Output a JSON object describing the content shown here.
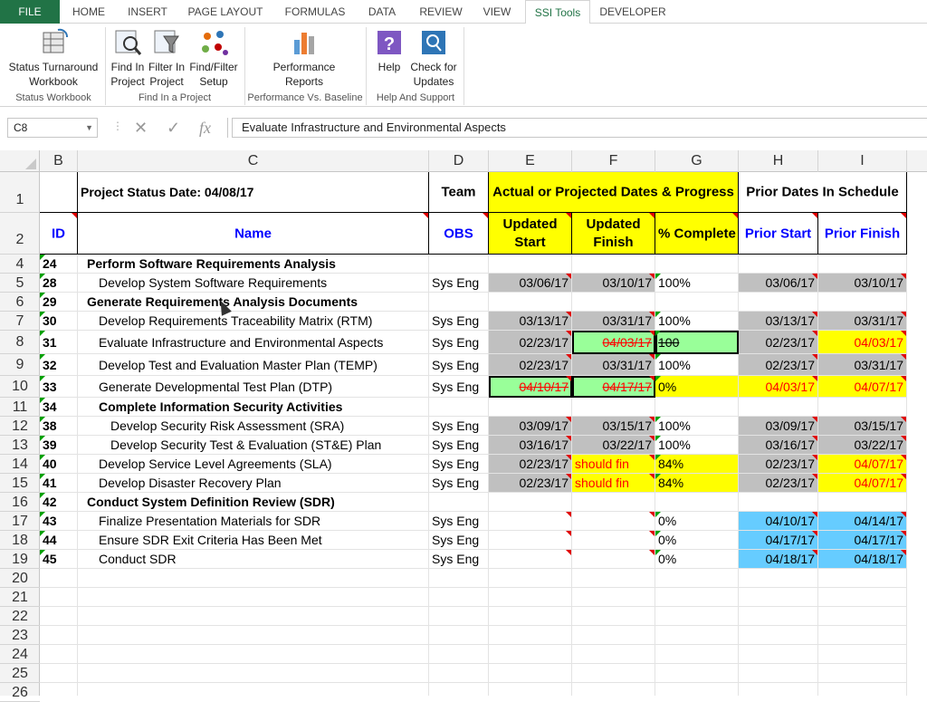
{
  "tabs": [
    "FILE",
    "HOME",
    "INSERT",
    "PAGE LAYOUT",
    "FORMULAS",
    "DATA",
    "REVIEW",
    "VIEW",
    "SSI Tools",
    "DEVELOPER"
  ],
  "ribbon": {
    "status_turnaround": [
      "Status Turnaround",
      "Workbook"
    ],
    "find_in_project": [
      "Find In",
      "Project"
    ],
    "filter_in_project": [
      "Filter In",
      "Project"
    ],
    "find_filter_setup": [
      "Find/Filter",
      "Setup"
    ],
    "performance_reports": [
      "Performance",
      "Reports"
    ],
    "help": "Help",
    "check_updates": [
      "Check for",
      "Updates"
    ],
    "groups": [
      "Status Workbook",
      "Find In a Project",
      "Performance Vs. Baseline",
      "Help And Support"
    ]
  },
  "formula_bar": {
    "name_box": "C8",
    "fx": "fx",
    "value": "Evaluate Infrastructure and Environmental Aspects"
  },
  "columns": [
    "B",
    "C",
    "D",
    "E",
    "F",
    "G",
    "H",
    "I"
  ],
  "rows": [
    "1",
    "2",
    "4",
    "5",
    "6",
    "7",
    "8",
    "9",
    "10",
    "11",
    "12",
    "13",
    "14",
    "15",
    "16",
    "17",
    "18",
    "19",
    "20",
    "21",
    "22",
    "23",
    "24",
    "25",
    "26"
  ],
  "header": {
    "status_date": "Project Status Date: 04/08/17",
    "team": "Team",
    "actual": "Actual or Projected Dates & Progress",
    "prior": "Prior Dates In Schedule",
    "id": "ID",
    "name": "Name",
    "obs": "OBS",
    "upd_start": [
      "Updated",
      "Start"
    ],
    "upd_finish": [
      "Updated",
      "Finish"
    ],
    "pct": "% Complete",
    "prior_start": "Prior Start",
    "prior_finish": "Prior Finish"
  },
  "data_rows": [
    {
      "id": "24",
      "name": "Perform Software Requirements Analysis",
      "summary": true,
      "indent": 1
    },
    {
      "id": "28",
      "name": "Develop System Software Requirements",
      "obs": "Sys Eng",
      "us": "03/06/17",
      "uf": "03/10/17",
      "pct": "100%",
      "ps": "03/06/17",
      "pf": "03/10/17",
      "indent": 2
    },
    {
      "id": "29",
      "name": "Generate Requirements Analysis Documents",
      "summary": true,
      "indent": 1
    },
    {
      "id": "30",
      "name": "Develop Requirements Traceability Matrix (RTM)",
      "obs": "Sys Eng",
      "us": "03/13/17",
      "uf": "03/31/17",
      "pct": "100%",
      "ps": "03/13/17",
      "pf": "03/31/17",
      "indent": 2
    },
    {
      "id": "31",
      "name": "Evaluate Infrastructure and Environmental Aspects",
      "obs": "Sys Eng",
      "us": "02/23/17",
      "uf": "04/03/17",
      "pct": "100",
      "ps": "02/23/17",
      "pf": "04/03/17",
      "indent": 2
    },
    {
      "id": "32",
      "name": "Develop Test and Evaluation Master Plan (TEMP)",
      "obs": "Sys Eng",
      "us": "02/23/17",
      "uf": "03/31/17",
      "pct": "100%",
      "ps": "02/23/17",
      "pf": "03/31/17",
      "indent": 2
    },
    {
      "id": "33",
      "name": "Generate Developmental Test Plan (DTP)",
      "obs": "Sys Eng",
      "us": "04/10/17",
      "uf": "04/17/17",
      "pct": "0%",
      "ps": "04/03/17",
      "pf": "04/07/17",
      "indent": 2
    },
    {
      "id": "34",
      "name": "Complete Information Security Activities",
      "summary": true,
      "indent": 2
    },
    {
      "id": "38",
      "name": "Develop Security Risk Assessment (SRA)",
      "obs": "Sys Eng",
      "us": "03/09/17",
      "uf": "03/15/17",
      "pct": "100%",
      "ps": "03/09/17",
      "pf": "03/15/17",
      "indent": 3
    },
    {
      "id": "39",
      "name": "Develop Security Test & Evaluation (ST&E) Plan",
      "obs": "Sys Eng",
      "us": "03/16/17",
      "uf": "03/22/17",
      "pct": "100%",
      "ps": "03/16/17",
      "pf": "03/22/17",
      "indent": 3
    },
    {
      "id": "40",
      "name": "Develop Service Level Agreements (SLA)",
      "obs": "Sys Eng",
      "us": "02/23/17",
      "uf": "should fin",
      "pct": "84%",
      "ps": "02/23/17",
      "pf": "04/07/17",
      "indent": 2
    },
    {
      "id": "41",
      "name": "Develop Disaster Recovery Plan",
      "obs": "Sys Eng",
      "us": "02/23/17",
      "uf": "should fin",
      "pct": "84%",
      "ps": "02/23/17",
      "pf": "04/07/17",
      "indent": 2
    },
    {
      "id": "42",
      "name": "Conduct System Definition Review (SDR)",
      "summary": true,
      "indent": 1
    },
    {
      "id": "43",
      "name": "Finalize Presentation Materials for SDR",
      "obs": "Sys Eng",
      "us": "",
      "uf": "",
      "pct": "0%",
      "ps": "04/10/17",
      "pf": "04/14/17",
      "indent": 2
    },
    {
      "id": "44",
      "name": "Ensure SDR Exit Criteria Has Been Met",
      "obs": "Sys Eng",
      "us": "",
      "uf": "",
      "pct": "0%",
      "ps": "04/17/17",
      "pf": "04/17/17",
      "indent": 2
    },
    {
      "id": "45",
      "name": "Conduct SDR",
      "obs": "Sys Eng",
      "us": "",
      "uf": "",
      "pct": "0%",
      "ps": "04/18/17",
      "pf": "04/18/17",
      "indent": 2
    }
  ],
  "colors": {
    "gray": "#c0c0c0",
    "yellow": "#ffff00",
    "green": "#99ff99",
    "sky": "#66ccff",
    "excel_green": "#217346"
  }
}
